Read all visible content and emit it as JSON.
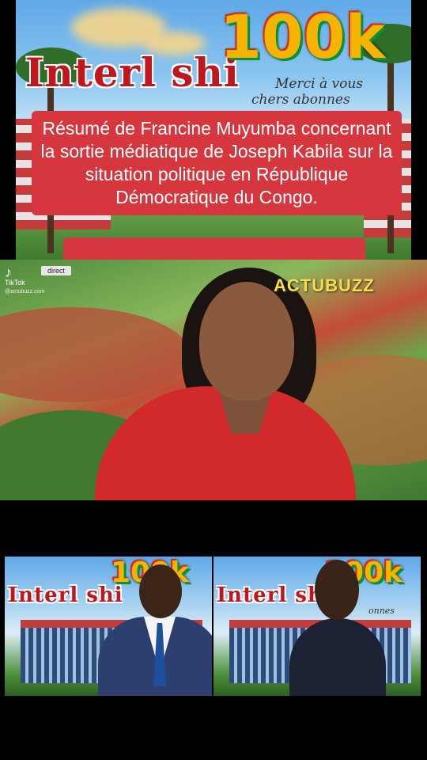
{
  "banner": {
    "brand": "Interl shi",
    "count": "100k",
    "thanks_line1": "Merci à vous",
    "thanks_line2": "chers abonnes"
  },
  "caption": {
    "text": "Résumé de Francine Muyumba concernant la sortie médiatique de Joseph Kabila sur la situation politique en République Démocratique du Congo."
  },
  "video": {
    "platform": "TikTok",
    "handle": "@actubuzz.com",
    "badge": "direct",
    "watermark": "ACTUBUZZ"
  },
  "thumbnails": [
    {
      "brand": "Interl shi",
      "count": "100k"
    },
    {
      "brand": "Interl shi",
      "count": "100k",
      "thanks": "onnes"
    }
  ],
  "colors": {
    "caption_bg": "#d6363e",
    "brand_red": "#c0161d",
    "count_yellow": "#f4b400",
    "watermark_yellow": "#f3e047",
    "jacket_red": "#d22a2b"
  }
}
